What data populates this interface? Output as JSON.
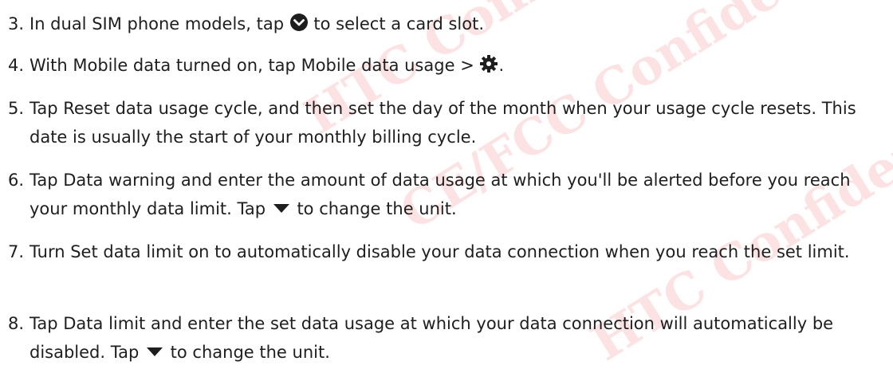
{
  "watermark": {
    "line1": "HTC Confidential",
    "line2": "CE/FCC Confidential",
    "line3": "HTC Confidential",
    "color": "#e8303a"
  },
  "steps": {
    "s3": {
      "number": "3.",
      "before": "In dual SIM phone models, tap",
      "icon": "circle-chevron-down-icon",
      "after": "to select a card slot."
    },
    "s4": {
      "number": "4.",
      "before": "With Mobile data turned on, tap",
      "term": "Mobile data usage",
      "separator": ">",
      "icon": "gear-icon",
      "after": "."
    },
    "s5": {
      "number": "5.",
      "before": "Tap",
      "term": "Reset data usage cycle",
      "after": ", and then set the day of the month when your usage cycle resets. This date is usually the start of your monthly billing cycle."
    },
    "s6": {
      "number": "6.",
      "before": "Tap",
      "term": "Data warning",
      "middle": "and enter the amount of data usage at which you'll be alerted before you reach your monthly data limit. Tap",
      "icon": "triangle-down-icon",
      "after": "to change the unit."
    },
    "s7": {
      "number": "7.",
      "before": "Turn",
      "term": "Set data limit",
      "after": "on to automatically disable your data connection when you reach the set limit."
    },
    "s8": {
      "number": "8.",
      "before": "Tap",
      "term": "Data limit",
      "middle": "and enter the set data usage at which your data connection will automatically be disabled. Tap",
      "icon": "triangle-down-icon",
      "after": "to change the unit."
    }
  }
}
